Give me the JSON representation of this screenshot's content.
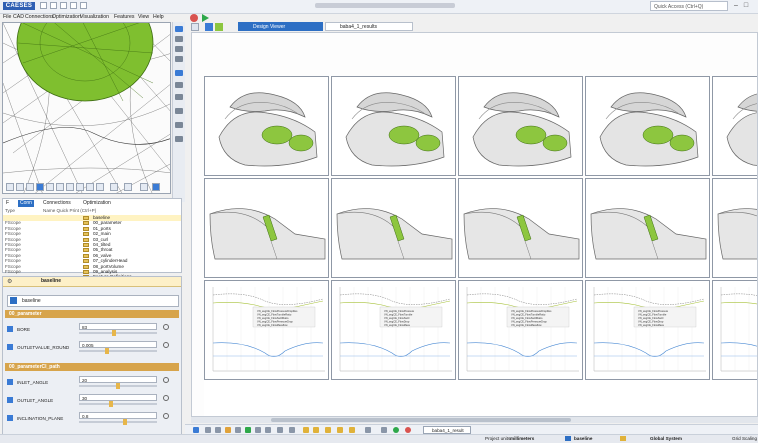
{
  "app": {
    "logo": "CAESES"
  },
  "quick_access": "Quick Access (Ctrl+Q)",
  "menu": [
    "File",
    "CAD",
    "Connections",
    "Optimization",
    "Visualization",
    "Features",
    "View",
    "Help"
  ],
  "tabs": [
    {
      "label": "Design Viewer",
      "active": true
    },
    {
      "label": "baba4_1_results",
      "active": false
    }
  ],
  "panel_tabs": [
    "F",
    "Conn",
    "Connections",
    "Optimization"
  ],
  "tree": {
    "columns": [
      "Type",
      "Name  Quick Print (Ctrl+P)"
    ],
    "rows": [
      {
        "type": "",
        "name": "baseline",
        "selected": true
      },
      {
        "type": "FScope",
        "name": "00_parameter"
      },
      {
        "type": "FScope",
        "name": "01_ports"
      },
      {
        "type": "FScope",
        "name": "02_main"
      },
      {
        "type": "FScope",
        "name": "03_curl"
      },
      {
        "type": "FScope",
        "name": "04_tilted"
      },
      {
        "type": "FScope",
        "name": "05_throat"
      },
      {
        "type": "FScope",
        "name": "06_valve"
      },
      {
        "type": "FScope",
        "name": "07_cylinderHead"
      },
      {
        "type": "FScope",
        "name": "08_portVolume"
      },
      {
        "type": "FScope",
        "name": "09_analysis"
      },
      {
        "type": "",
        "name": "Feature Definitions"
      }
    ]
  },
  "props": {
    "title": "baseline",
    "header_icon": "gear-icon",
    "object": "baseline",
    "sections": [
      {
        "title": "00_parameter",
        "params": [
          {
            "label": "BORE",
            "value": "83",
            "level": 0.45
          },
          {
            "label": "OUTLETVALUE_ROUND",
            "value": "0.005",
            "level": 0.35
          }
        ]
      },
      {
        "title": "00_parameterCl_path",
        "params": [
          {
            "label": "INLET_ANGLE",
            "value": "20",
            "level": 0.5
          },
          {
            "label": "OUTLET_ANGLE",
            "value": "30",
            "level": 0.4
          },
          {
            "label": "INCLINATION_PLANE",
            "value": "0.8",
            "level": 0.6
          }
        ]
      }
    ]
  },
  "bottom": {
    "result_tab": "baba4_1_result",
    "project_units_label": "Project units:",
    "project_units": "millimeters",
    "scope": "baseline",
    "coord_system": "Global System",
    "grid_label": "Grid Scaling"
  },
  "charts": {
    "legend_items": [
      "VN_avgCE_FlowPressureDropRes",
      "VN_avgCE_FlowTumbleRatio",
      "VN_avgCE_FlowSwirlRatio",
      "VN_avgCE_FlowPressureDrop",
      "VN_avgCE_FlowMassflow"
    ],
    "legend_items_short": [
      "VN_avgCE_FlowPressure",
      "VN_avgCE_FlowTumble",
      "VN_avgCE_FlowSwirl",
      "VN_avgCE_FlowDrop",
      "VN_avgCE_FlowMass"
    ]
  },
  "colors": {
    "accent": "#2d6fc4",
    "port_green": "#8dc63f",
    "section": "#d7a44b"
  }
}
